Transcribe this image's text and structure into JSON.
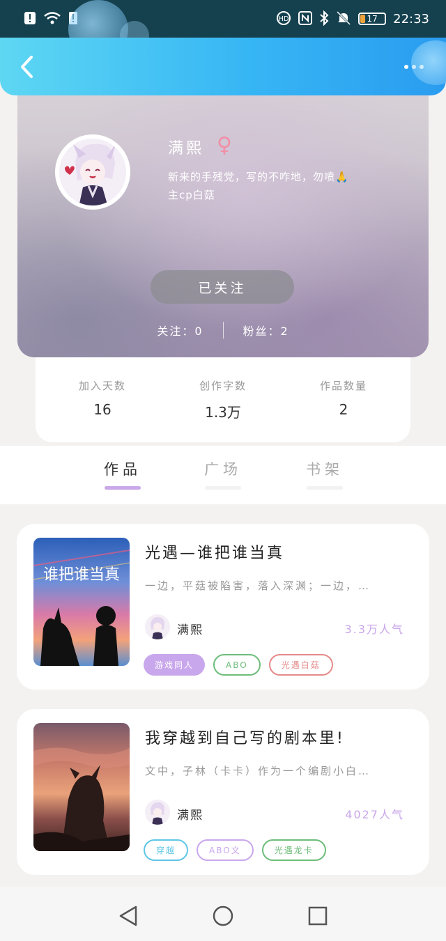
{
  "status_bar": {
    "time": "22:33",
    "battery": "17"
  },
  "header": {
    "back_icon": "chevron-left-icon",
    "more_icon": "more-dots-icon"
  },
  "profile": {
    "name": "满熙",
    "gender_symbol": "♀",
    "bio": "新来的手残党，写的不咋地，勿喷🙏",
    "bio_line2": "主cp白菇",
    "follow_button": "已关注",
    "following_label": "关注：0",
    "followers_label": "粉丝：2"
  },
  "stats": [
    {
      "label": "加入天数",
      "value": "16"
    },
    {
      "label": "创作字数",
      "value": "1.3万"
    },
    {
      "label": "作品数量",
      "value": "2"
    }
  ],
  "tabs": [
    {
      "label": "作品",
      "active": true
    },
    {
      "label": "广场",
      "active": false
    },
    {
      "label": "书架",
      "active": false
    }
  ],
  "works": [
    {
      "title": "光遇—谁把谁当真",
      "description": "一边，平菇被陷害，落入深渊；一边，…",
      "author": "满熙",
      "popularity": "3.3万人气",
      "cover_text": "谁把谁当真",
      "tags": [
        {
          "label": "游戏同人",
          "style": "filled",
          "color": "#c9a7ec"
        },
        {
          "label": "ABO",
          "style": "outline",
          "color": "#6dbd7a"
        },
        {
          "label": "光遇白菇",
          "style": "outline",
          "color": "#e48a8a"
        }
      ]
    },
    {
      "title": "我穿越到自己写的剧本里!",
      "description": "文中，子林（卡卡）作为一个编剧小白…",
      "author": "满熙",
      "popularity": "4027人气",
      "tags": [
        {
          "label": "穿越",
          "style": "outline",
          "color": "#5fc6e6"
        },
        {
          "label": "ABO文",
          "style": "outline",
          "color": "#c9a7ec"
        },
        {
          "label": "光遇龙卡",
          "style": "outline",
          "color": "#6dbd7a"
        }
      ]
    }
  ]
}
